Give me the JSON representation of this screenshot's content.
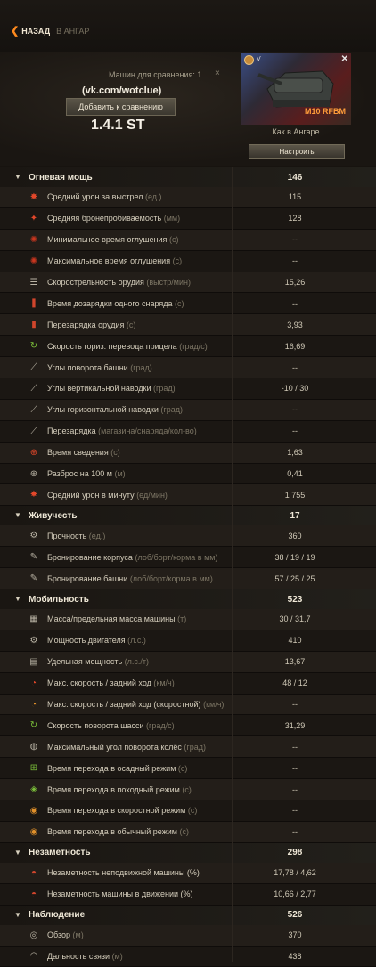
{
  "nav": {
    "back": "НАЗАД",
    "hangar": "В АНГАР"
  },
  "compare": {
    "label": "Машин для сравнения: 1",
    "close": "×",
    "vk": "(vk.com/wotclue)",
    "add_button": "Добавить к сравнению",
    "version": "1.4.1 ST"
  },
  "vehicle": {
    "tier": "V",
    "name": "M10 RFBM",
    "close": "✕",
    "status": "Как в Ангаре",
    "setup_button": "Настроить"
  },
  "sections": [
    {
      "title": "Огневая мощь",
      "value": "146",
      "rows": [
        {
          "icon": "damage-icon",
          "glyph": "✸",
          "color": "#e2472a",
          "label": "Средний урон за выстрел",
          "unit": "(ед.)",
          "value": "115"
        },
        {
          "icon": "penetration-icon",
          "glyph": "✦",
          "color": "#e2472a",
          "label": "Средняя бронепробиваемость",
          "unit": "(мм)",
          "value": "128"
        },
        {
          "icon": "stun-min-icon",
          "glyph": "✺",
          "color": "#c9361f",
          "label": "Минимальное время оглушения",
          "unit": "(с)",
          "value": "--"
        },
        {
          "icon": "stun-max-icon",
          "glyph": "✺",
          "color": "#c9361f",
          "label": "Максимальное время оглушения",
          "unit": "(с)",
          "value": "--"
        },
        {
          "icon": "rate-of-fire-icon",
          "glyph": "☰",
          "color": "#b9b3a4",
          "label": "Скорострельность орудия",
          "unit": "(выстр/мин)",
          "value": "15,26"
        },
        {
          "icon": "shell-reload-icon",
          "glyph": "❚",
          "color": "#d0452c",
          "label": "Время дозарядки одного снаряда",
          "unit": "(с)",
          "value": "--"
        },
        {
          "icon": "reload-icon",
          "glyph": "▮",
          "color": "#d0452c",
          "label": "Перезарядка орудия",
          "unit": "(с)",
          "value": "3,93"
        },
        {
          "icon": "traverse-icon",
          "glyph": "↻",
          "color": "#7bbf3a",
          "label": "Скорость гориз. перевода прицела",
          "unit": "(град/с)",
          "value": "16,69"
        },
        {
          "icon": "turret-angle-icon",
          "glyph": "⟋",
          "color": "#b9b3a4",
          "label": "Углы поворота башни",
          "unit": "(град)",
          "value": "--"
        },
        {
          "icon": "elevation-icon",
          "glyph": "⟋",
          "color": "#b9b3a4",
          "label": "Углы вертикальной наводки",
          "unit": "(град)",
          "value": "-10 / 30"
        },
        {
          "icon": "horizontal-angle-icon",
          "glyph": "⟋",
          "color": "#b9b3a4",
          "label": "Углы горизонтальной наводки",
          "unit": "(град)",
          "value": "--"
        },
        {
          "icon": "magazine-icon",
          "glyph": "⟋",
          "color": "#b9b3a4",
          "label": "Перезарядка",
          "unit": "(магазина/снаряда/кол-во)",
          "value": "--"
        },
        {
          "icon": "aim-time-icon",
          "glyph": "⊕",
          "color": "#e2472a",
          "label": "Время сведения",
          "unit": "(с)",
          "value": "1,63"
        },
        {
          "icon": "dispersion-icon",
          "glyph": "⊕",
          "color": "#b9b3a4",
          "label": "Разброс на 100 м",
          "unit": "(м)",
          "value": "0,41"
        },
        {
          "icon": "dpm-icon",
          "glyph": "✸",
          "color": "#e2472a",
          "label": "Средний урон в минуту",
          "unit": "(ед/мин)",
          "value": "1 755"
        }
      ]
    },
    {
      "title": "Живучесть",
      "value": "17",
      "rows": [
        {
          "icon": "hit-points-icon",
          "glyph": "⚙",
          "color": "#b9b3a4",
          "label": "Прочность",
          "unit": "(ед.)",
          "value": "360"
        },
        {
          "icon": "hull-armor-icon",
          "glyph": "✎",
          "color": "#b9b3a4",
          "label": "Бронирование корпуса",
          "unit": "(лоб/борт/корма в мм)",
          "value": "38 / 19 / 19"
        },
        {
          "icon": "turret-armor-icon",
          "glyph": "✎",
          "color": "#b9b3a4",
          "label": "Бронирование башни",
          "unit": "(лоб/борт/корма в мм)",
          "value": "57 / 25 / 25"
        }
      ]
    },
    {
      "title": "Мобильность",
      "value": "523",
      "rows": [
        {
          "icon": "weight-icon",
          "glyph": "▦",
          "color": "#b9b3a4",
          "label": "Масса/предельная масса машины",
          "unit": "(т)",
          "value": "30 / 31,7"
        },
        {
          "icon": "engine-icon",
          "glyph": "⚙",
          "color": "#b9b3a4",
          "label": "Мощность двигателя",
          "unit": "(л.с.)",
          "value": "410"
        },
        {
          "icon": "specific-power-icon",
          "glyph": "▤",
          "color": "#b9b3a4",
          "label": "Удельная мощность",
          "unit": "(л.с./т)",
          "value": "13,67"
        },
        {
          "icon": "speed-icon",
          "glyph": "◔",
          "color": "#e2472a",
          "label": "Макс. скорость / задний ход",
          "unit": "(км/ч)",
          "value": "48 / 12"
        },
        {
          "icon": "speed-fast-icon",
          "glyph": "◔",
          "color": "#e0902a",
          "label": "Макс. скорость / задний ход (скоростной)",
          "unit": "(км/ч)",
          "value": "--"
        },
        {
          "icon": "hull-traverse-icon",
          "glyph": "↻",
          "color": "#7bbf3a",
          "label": "Скорость поворота шасси",
          "unit": "(град/с)",
          "value": "31,29"
        },
        {
          "icon": "wheel-angle-icon",
          "glyph": "◍",
          "color": "#b9b3a4",
          "label": "Максимальный угол поворота колёс",
          "unit": "(град)",
          "value": "--"
        },
        {
          "icon": "siege-mode-icon",
          "glyph": "⊞",
          "color": "#7bbf3a",
          "label": "Время перехода в осадный режим",
          "unit": "(с)",
          "value": "--"
        },
        {
          "icon": "travel-mode-icon",
          "glyph": "◈",
          "color": "#7bbf3a",
          "label": "Время перехода в походный режим",
          "unit": "(с)",
          "value": "--"
        },
        {
          "icon": "fast-mode-icon",
          "glyph": "◉",
          "color": "#e0902a",
          "label": "Время перехода в скоростной режим",
          "unit": "(с)",
          "value": "--"
        },
        {
          "icon": "normal-mode-icon",
          "glyph": "◉",
          "color": "#e0902a",
          "label": "Время перехода в обычный режим",
          "unit": "(с)",
          "value": "--"
        }
      ]
    },
    {
      "title": "Незаметность",
      "value": "298",
      "rows": [
        {
          "icon": "stationary-camo-icon",
          "glyph": "◓",
          "color": "#d0452c",
          "label": "Незаметность неподвижной машины",
          "unit": "(%)",
          "value": "17,78 / 4,62",
          "unit_plain": true
        },
        {
          "icon": "moving-camo-icon",
          "glyph": "◓",
          "color": "#d0452c",
          "label": "Незаметность машины в движении",
          "unit": "(%)",
          "value": "10,66 / 2,77",
          "unit_plain": true
        }
      ]
    },
    {
      "title": "Наблюдение",
      "value": "526",
      "rows": [
        {
          "icon": "view-range-icon",
          "glyph": "◎",
          "color": "#b9b3a4",
          "label": "Обзор",
          "unit": "(м)",
          "value": "370"
        },
        {
          "icon": "radio-range-icon",
          "glyph": "◠",
          "color": "#b9b3a4",
          "label": "Дальность связи",
          "unit": "(м)",
          "value": "438"
        }
      ]
    }
  ]
}
